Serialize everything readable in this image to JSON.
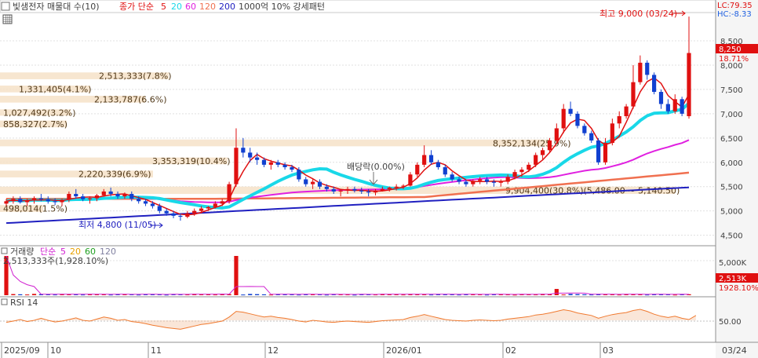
{
  "header": {
    "title": "빛샘전자 매물대 수(10)",
    "ma_title": "종가 단순",
    "ma_periods": [
      "5",
      "20",
      "60",
      "120",
      "200"
    ],
    "ma_colors": [
      "#e01010",
      "#19d8e8",
      "#e020e0",
      "#f07050",
      "#2020c0"
    ],
    "volume_profile_label": "1000억 10% 강세패턴",
    "lc_label": "LC:79.35",
    "hc_label": "HC:-8.33"
  },
  "price_panel": {
    "yaxis_ticks": [
      "8,500",
      "8,000",
      "7,500",
      "7,000",
      "6,500",
      "6,000",
      "5,500",
      "5,000",
      "4,500"
    ],
    "current_price": "8,250",
    "current_change": "18.71%",
    "high_label": "최고 9,000 (03/24)",
    "low_label": "최저 4,800 (11/05)",
    "dividend_label": "배당락(0.00%)",
    "profile_labels": [
      "2,513,333(7.8%)",
      "1,331,405(4.1%)",
      "2,133,787(6.6%)",
      "1,027,492(3.2%)",
      "858,327(2.7%)",
      "8,352,134(25.9%)",
      "3,353,319(10.4%)",
      "2,220,339(6.9%)",
      "9,904,400(30.8%)(5,486.00 ~ 5,140.50)",
      "498,014(1.5%)"
    ]
  },
  "volume_panel": {
    "title": "거래량",
    "ma_title": "단순",
    "ma_periods": [
      "5",
      "20",
      "60",
      "120"
    ],
    "ma_colors": [
      "#d020d0",
      "#e8a000",
      "#20a020",
      "#8080a0"
    ],
    "annotation": "2,513,333주(1,928.10%)",
    "yaxis_tick": "5,000K",
    "current_value": "2,513K",
    "current_change": "1928.10%"
  },
  "rsi_panel": {
    "title": "RSI 14",
    "yaxis_tick": "50.00"
  },
  "xaxis": {
    "labels": [
      "2025/09",
      "10",
      "11",
      "12",
      "2026/01",
      "02",
      "03"
    ],
    "last_date": "03/24"
  },
  "chart_data": [
    {
      "type": "candlestick",
      "title": "빛샘전자",
      "ylim": [
        4300,
        9050
      ],
      "ohlc_summary": [
        [
          5150,
          5250,
          5100,
          5200
        ],
        [
          5200,
          5300,
          5150,
          5250
        ],
        [
          5250,
          5300,
          5150,
          5180
        ],
        [
          5180,
          5250,
          5100,
          5220
        ],
        [
          5220,
          5300,
          5150,
          5260
        ],
        [
          5260,
          5350,
          5200,
          5240
        ],
        [
          5240,
          5300,
          5150,
          5200
        ],
        [
          5200,
          5260,
          5120,
          5180
        ],
        [
          5180,
          5250,
          5100,
          5230
        ],
        [
          5230,
          5400,
          5180,
          5350
        ],
        [
          5350,
          5450,
          5250,
          5300
        ],
        [
          5300,
          5350,
          5200,
          5240
        ],
        [
          5240,
          5300,
          5150,
          5260
        ],
        [
          5260,
          5350,
          5200,
          5320
        ],
        [
          5320,
          5450,
          5300,
          5400
        ],
        [
          5400,
          5480,
          5300,
          5350
        ],
        [
          5350,
          5400,
          5250,
          5300
        ],
        [
          5300,
          5380,
          5250,
          5350
        ],
        [
          5350,
          5400,
          5200,
          5250
        ],
        [
          5250,
          5300,
          5150,
          5200
        ],
        [
          5200,
          5250,
          5100,
          5150
        ],
        [
          5150,
          5200,
          5050,
          5100
        ],
        [
          5100,
          5150,
          4950,
          5000
        ],
        [
          5000,
          5050,
          4900,
          4950
        ],
        [
          4950,
          5000,
          4850,
          4900
        ],
        [
          4900,
          4950,
          4800,
          4880
        ],
        [
          4880,
          5000,
          4850,
          4950
        ],
        [
          4950,
          5050,
          4900,
          5000
        ],
        [
          5000,
          5100,
          4950,
          5050
        ],
        [
          5050,
          5100,
          5000,
          5080
        ],
        [
          5080,
          5200,
          5050,
          5150
        ],
        [
          5150,
          5250,
          5100,
          5200
        ],
        [
          5200,
          5600,
          5150,
          5550
        ],
        [
          5550,
          6700,
          5500,
          6300
        ],
        [
          6300,
          6500,
          6100,
          6200
        ],
        [
          6200,
          6300,
          6000,
          6100
        ],
        [
          6100,
          6200,
          5950,
          6050
        ],
        [
          6050,
          6100,
          5900,
          5950
        ],
        [
          5950,
          6050,
          5850,
          6000
        ],
        [
          6000,
          6050,
          5900,
          5950
        ],
        [
          5950,
          6000,
          5850,
          5900
        ],
        [
          5900,
          5950,
          5800,
          5850
        ],
        [
          5850,
          5900,
          5600,
          5650
        ],
        [
          5650,
          5700,
          5500,
          5550
        ],
        [
          5550,
          5650,
          5450,
          5600
        ],
        [
          5600,
          5650,
          5450,
          5500
        ],
        [
          5500,
          5550,
          5400,
          5450
        ],
        [
          5450,
          5500,
          5350,
          5400
        ],
        [
          5400,
          5450,
          5300,
          5420
        ],
        [
          5420,
          5500,
          5350,
          5450
        ],
        [
          5450,
          5500,
          5380,
          5420
        ],
        [
          5420,
          5480,
          5350,
          5400
        ],
        [
          5400,
          5450,
          5300,
          5380
        ],
        [
          5380,
          5450,
          5320,
          5420
        ],
        [
          5420,
          5500,
          5400,
          5450
        ],
        [
          5450,
          5500,
          5400,
          5480
        ],
        [
          5480,
          5550,
          5420,
          5500
        ],
        [
          5500,
          5550,
          5450,
          5520
        ],
        [
          5520,
          5800,
          5500,
          5750
        ],
        [
          5750,
          6000,
          5700,
          5950
        ],
        [
          5950,
          6350,
          5900,
          6150
        ],
        [
          6150,
          6250,
          5950,
          6000
        ],
        [
          6000,
          6050,
          5850,
          5900
        ],
        [
          5900,
          5950,
          5700,
          5750
        ],
        [
          5750,
          5800,
          5600,
          5650
        ],
        [
          5650,
          5700,
          5550,
          5600
        ],
        [
          5600,
          5650,
          5500,
          5550
        ],
        [
          5550,
          5650,
          5500,
          5620
        ],
        [
          5620,
          5700,
          5550,
          5650
        ],
        [
          5650,
          5700,
          5550,
          5600
        ],
        [
          5600,
          5650,
          5500,
          5580
        ],
        [
          5580,
          5650,
          5500,
          5600
        ],
        [
          5600,
          5750,
          5550,
          5700
        ],
        [
          5700,
          5850,
          5650,
          5800
        ],
        [
          5800,
          5900,
          5700,
          5850
        ],
        [
          5850,
          6000,
          5800,
          5950
        ],
        [
          5950,
          6200,
          5900,
          6150
        ],
        [
          6150,
          6300,
          6050,
          6250
        ],
        [
          6250,
          6500,
          6200,
          6450
        ],
        [
          6450,
          6800,
          6400,
          6700
        ],
        [
          6700,
          7200,
          6600,
          7100
        ],
        [
          7100,
          7250,
          6950,
          7000
        ],
        [
          7000,
          7050,
          6700,
          6750
        ],
        [
          6750,
          6800,
          6550,
          6600
        ],
        [
          6600,
          6650,
          6400,
          6450
        ],
        [
          6450,
          6500,
          5950,
          6000
        ],
        [
          6000,
          6500,
          5950,
          6400
        ],
        [
          6400,
          6900,
          6350,
          6800
        ],
        [
          6800,
          7050,
          6700,
          6950
        ],
        [
          6950,
          7200,
          6900,
          7150
        ],
        [
          7150,
          8000,
          7100,
          7650
        ],
        [
          7650,
          8200,
          7600,
          8050
        ],
        [
          8050,
          8100,
          7700,
          7800
        ],
        [
          7800,
          7850,
          7400,
          7450
        ],
        [
          7450,
          7500,
          7100,
          7200
        ],
        [
          7200,
          7300,
          7000,
          7050
        ],
        [
          7050,
          7400,
          7000,
          7300
        ],
        [
          7300,
          7350,
          6950,
          7000
        ],
        [
          6950,
          9000,
          6900,
          8250
        ]
      ],
      "moving_averages": [
        "MA5",
        "MA20",
        "MA60",
        "MA120",
        "MA200"
      ]
    },
    {
      "type": "bar",
      "title": "거래량",
      "ylabel": "K",
      "spikes": [
        {
          "x_index": 0,
          "value": 2513
        },
        {
          "x_index": 33,
          "value": 2513
        },
        {
          "x_index": 79,
          "value": 400
        },
        {
          "x_index": 99,
          "value": 2513
        }
      ]
    },
    {
      "type": "line",
      "title": "RSI 14",
      "ylim": [
        0,
        100
      ],
      "values": [
        45,
        48,
        52,
        47,
        50,
        55,
        50,
        46,
        48,
        52,
        56,
        50,
        48,
        53,
        58,
        55,
        50,
        52,
        47,
        45,
        42,
        38,
        35,
        32,
        30,
        28,
        32,
        36,
        40,
        42,
        45,
        48,
        58,
        72,
        70,
        66,
        62,
        58,
        60,
        57,
        55,
        52,
        48,
        46,
        50,
        48,
        46,
        45,
        47,
        48,
        47,
        46,
        45,
        47,
        49,
        50,
        51,
        52,
        57,
        60,
        64,
        60,
        56,
        52,
        50,
        49,
        48,
        50,
        51,
        50,
        49,
        50,
        53,
        55,
        57,
        59,
        63,
        65,
        68,
        72,
        76,
        73,
        68,
        65,
        62,
        55,
        60,
        64,
        67,
        69,
        74,
        77,
        72,
        65,
        60,
        57,
        60,
        55,
        52,
        62
      ]
    }
  ]
}
